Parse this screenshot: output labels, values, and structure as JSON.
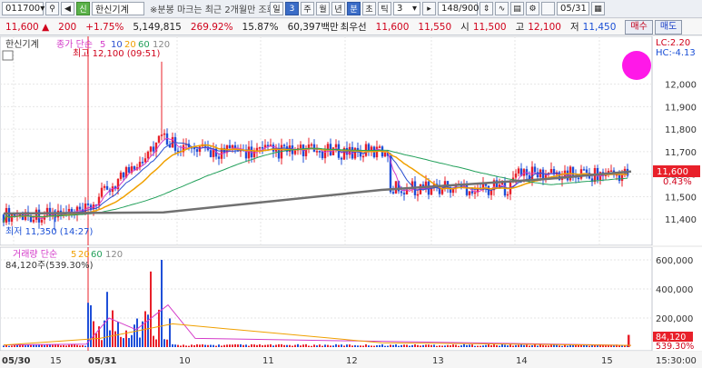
{
  "toolbar": {
    "code": "011700",
    "name_badge": "신",
    "name": "한신기계",
    "notice": "※분봉 마크는 최근 2개월만 조회",
    "period_buttons": [
      "일",
      "3",
      "주",
      "월",
      "년",
      "분",
      "초",
      "틱"
    ],
    "period_count": "3",
    "page": "148/900",
    "date": "05/31"
  },
  "quote": {
    "price": "11,600",
    "change": "200",
    "rate": "+1.75%",
    "volume": "5,149,815",
    "volume_rate": "269.92%",
    "turnover": "15.87%",
    "amount": "60,397백만",
    "bid_label": "최우선",
    "bid": "11,600",
    "ask": "11,550",
    "open_label": "시",
    "open": "11,500",
    "high_label": "고",
    "high": "12,100",
    "low_label": "저",
    "low": "11,450",
    "buy_label": "매수",
    "sell_label": "매도"
  },
  "price_panel": {
    "title": "한신기계",
    "legend_label": "종가 단순",
    "legend_periods": [
      "5",
      "10",
      "20",
      "60",
      "120"
    ],
    "high_note": "최고 12,100 (09:51)",
    "low_note": "최저 11,350 (14:27)",
    "lc": "LC:2.20",
    "hc": "HC:-4.13",
    "y_ticks": [
      "12,000",
      "11,900",
      "11,800",
      "11,700",
      "11,600",
      "11,500",
      "11,400"
    ],
    "current_price_badge": "11,600",
    "current_rate_badge": "0.43%"
  },
  "volume_panel": {
    "title": "거래량 단순",
    "legend_periods": [
      "5",
      "20",
      "60",
      "120"
    ],
    "current_value": "84,120주(539.30%)",
    "y_ticks": [
      "600,000",
      "400,000",
      "200,000"
    ],
    "badge_value": "84,120",
    "badge_rate": "539.30%"
  },
  "x_axis": {
    "labels": [
      "05/30",
      "15",
      "05/31",
      "10",
      "11",
      "12",
      "13",
      "14",
      "15"
    ],
    "time": "15:30:00"
  },
  "colors": {
    "up": "#e8202a",
    "down": "#1f4fd8",
    "ma5": "#d43bc9",
    "ma10": "#2a4fd0",
    "ma20": "#f0a000",
    "ma60": "#22a05a",
    "ma120": "#707070"
  }
}
